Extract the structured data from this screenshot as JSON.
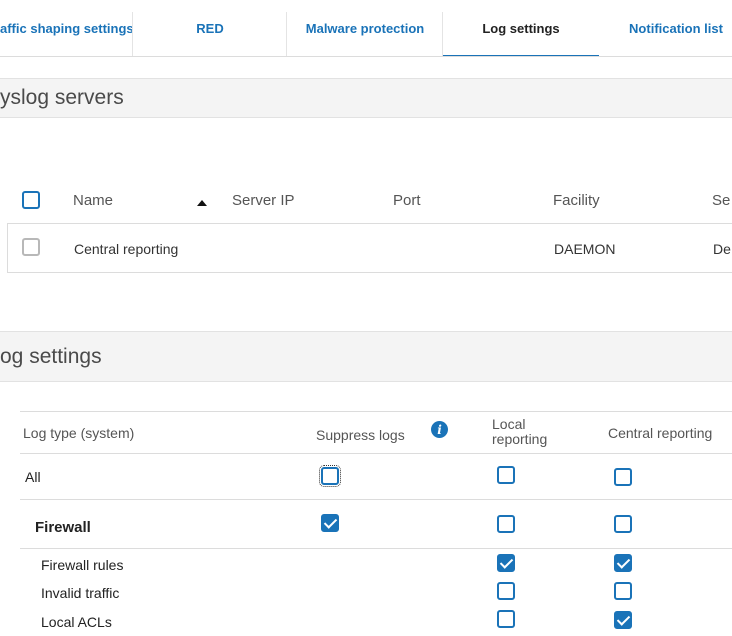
{
  "tabs": [
    {
      "label": "affic shaping settings"
    },
    {
      "label": "RED"
    },
    {
      "label": "Malware protection"
    },
    {
      "label": "Log settings"
    },
    {
      "label": "Notification list"
    }
  ],
  "syslog": {
    "title": "yslog servers",
    "columns": {
      "name": "Name",
      "server_ip": "Server IP",
      "port": "Port",
      "facility": "Facility",
      "severity": "Se"
    },
    "rows": [
      {
        "name": "Central reporting",
        "facility": "DAEMON",
        "severity": "De"
      }
    ]
  },
  "log_settings": {
    "title": "og settings",
    "columns": {
      "log_type": "Log type (system)",
      "suppress": "Suppress logs",
      "local": "Local\nreporting",
      "central": "Central reporting"
    },
    "rows": [
      {
        "label": "All",
        "suppress": false,
        "local": false,
        "central": false
      },
      {
        "label": "Firewall",
        "suppress": true,
        "local": false,
        "central": false
      },
      {
        "label": "Firewall rules",
        "local": true,
        "central": true
      },
      {
        "label": "Invalid traffic",
        "local": false,
        "central": false
      },
      {
        "label": "Local ACLs",
        "local": false,
        "central": true
      }
    ]
  },
  "colors": {
    "accent": "#1a73b8",
    "header_bg": "#f4f4f4",
    "border": "#dcdcdc"
  }
}
